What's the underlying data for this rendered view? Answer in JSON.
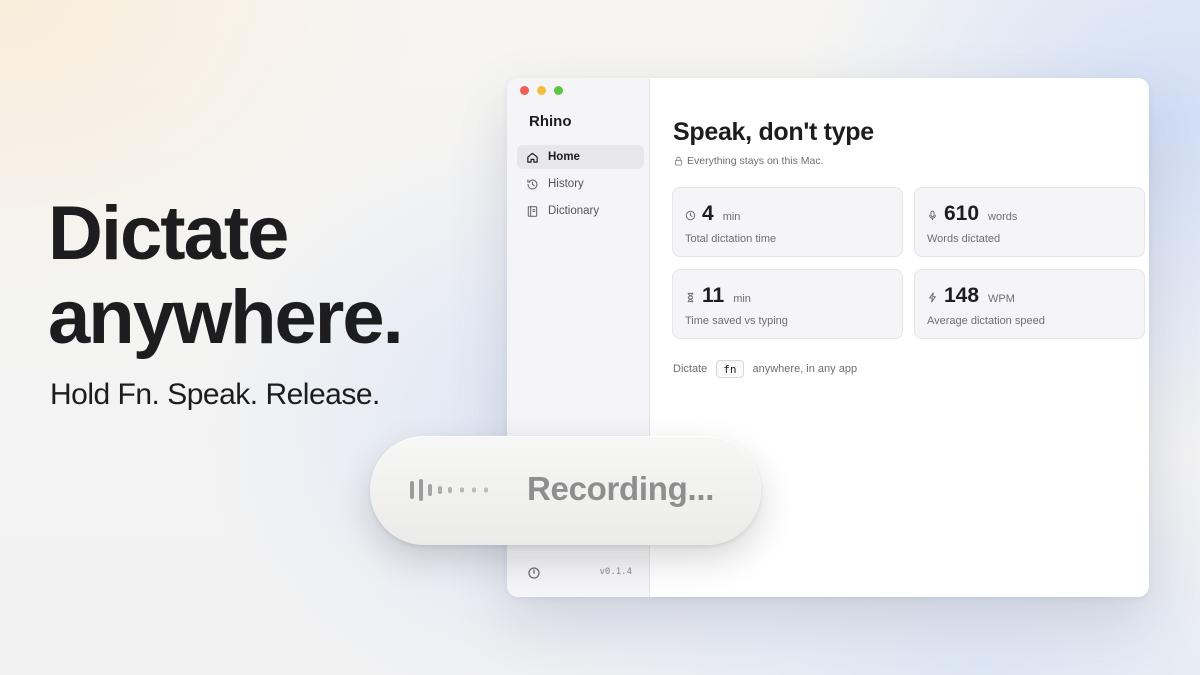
{
  "hero": {
    "title_line1": "Dictate",
    "title_line2": "anywhere.",
    "subtitle": "Hold Fn. Speak. Release."
  },
  "window": {
    "app_name": "Rhino",
    "nav": [
      {
        "label": "Home",
        "icon": "home-icon",
        "active": true
      },
      {
        "label": "History",
        "icon": "history-icon",
        "active": false
      },
      {
        "label": "Dictionary",
        "icon": "book-icon",
        "active": false
      }
    ],
    "version": "v0.1.4",
    "footer_icon": "power-icon"
  },
  "main": {
    "title": "Speak, don't type",
    "privacy_note": "Everything stays on this Mac.",
    "stats": [
      {
        "value": "4",
        "unit": "min",
        "label": "Total dictation time",
        "icon": "clock-icon"
      },
      {
        "value": "610",
        "unit": "words",
        "label": "Words dictated",
        "icon": "microphone-icon"
      },
      {
        "value": "11",
        "unit": "min",
        "label": "Time saved vs typing",
        "icon": "hourglass-icon"
      },
      {
        "value": "148",
        "unit": "WPM",
        "label": "Average dictation speed",
        "icon": "bolt-icon"
      }
    ],
    "hint": {
      "before": "Dictate",
      "key": "fn",
      "after": "anywhere, in any app"
    }
  },
  "recording": {
    "label": "Recording...",
    "icon": "waveform-icon"
  },
  "colors": {
    "close": "#ee5f57",
    "minimize": "#f5bd3b",
    "zoom": "#5dc544",
    "text_primary": "#1d1d1f",
    "text_secondary": "#6e6e73"
  }
}
